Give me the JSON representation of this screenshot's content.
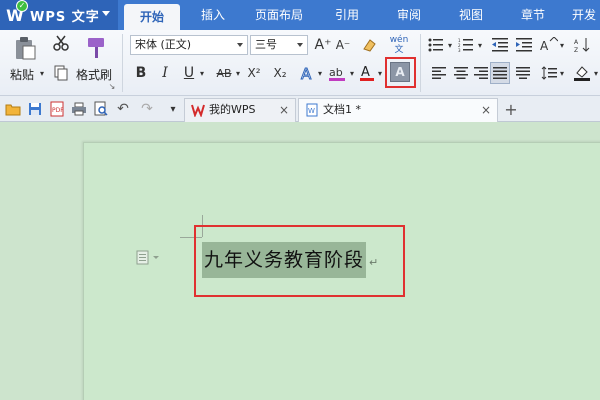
{
  "app": {
    "name": "WPS 文字"
  },
  "menu": {
    "tabs": [
      {
        "label": "开始",
        "active": true
      },
      {
        "label": "插入"
      },
      {
        "label": "页面布局"
      },
      {
        "label": "引用"
      },
      {
        "label": "审阅"
      },
      {
        "label": "视图"
      },
      {
        "label": "章节"
      },
      {
        "label": "开发"
      }
    ]
  },
  "ribbon": {
    "paste_label": "粘贴",
    "format_painter_label": "格式刷",
    "font_name": "宋体 (正文)",
    "font_size": "三号",
    "phonetic_label": "wén\n文",
    "bold": "B",
    "italic": "I",
    "underline": "U",
    "strikethrough": "AB",
    "superscript": "X²",
    "subscript": "X₂",
    "font_color_letter": "A",
    "char_shading_letter": "A",
    "grow_font": "A⁺",
    "shrink_font": "A⁻"
  },
  "tabsbar": {
    "tabs": [
      {
        "label": "我的WPS",
        "close": "×"
      },
      {
        "label": "文档1 *",
        "close": "×",
        "active": true
      }
    ],
    "new_tab": "+"
  },
  "document": {
    "text": "九年义务教育阶段",
    "paragraph_mark": "↵"
  },
  "colors": {
    "menubar": "#3d79cf",
    "page": "#cce8cc",
    "selection": "#98b698",
    "highlight_box": "#e03030",
    "wps_red": "#d42b2b"
  }
}
